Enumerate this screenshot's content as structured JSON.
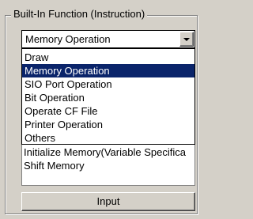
{
  "group": {
    "title": "Built-In Function (Instruction)"
  },
  "combo": {
    "selected": "Memory Operation"
  },
  "dropdown": {
    "items": [
      "Draw",
      "Memory Operation",
      "SIO Port Operation",
      "Bit Operation",
      "Operate CF File",
      "Printer Operation",
      "Others"
    ],
    "selected_index": 1
  },
  "instructions": {
    "items": [
      "Initialize Memory(Variable Specifica",
      "Shift Memory"
    ]
  },
  "buttons": {
    "input_label": "Input"
  },
  "colors": {
    "face": "#d4d0c8",
    "highlight": "#0a246a",
    "highlight_text": "#ffffff"
  }
}
